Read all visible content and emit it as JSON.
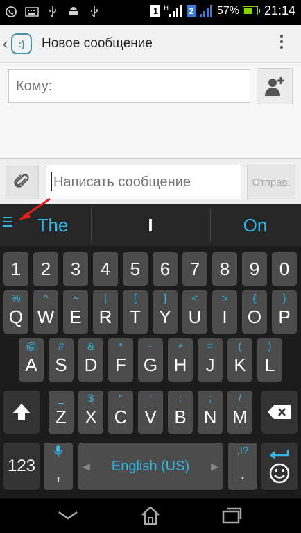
{
  "status_bar": {
    "sim1": "1",
    "net_tag": "H",
    "sim2": "2",
    "battery_percent": "57%",
    "battery_level": 0.57,
    "time": "21:14"
  },
  "action_bar": {
    "title": "Новое сообщение",
    "app_icon_glyph": ":)"
  },
  "recipient": {
    "placeholder": "Кому:"
  },
  "compose": {
    "placeholder": "Написать сообщение",
    "send_label": "Отправ."
  },
  "keyboard": {
    "suggestions": [
      "The",
      "I",
      "On"
    ],
    "number_row": [
      "1",
      "2",
      "3",
      "4",
      "5",
      "6",
      "7",
      "8",
      "9",
      "0"
    ],
    "row_q": {
      "keys": [
        "Q",
        "W",
        "E",
        "R",
        "T",
        "Y",
        "U",
        "I",
        "O",
        "P"
      ],
      "hints": [
        "%",
        "^",
        "~",
        "|",
        "[",
        "]",
        "<",
        ">",
        "{",
        "}"
      ]
    },
    "row_a": {
      "keys": [
        "A",
        "S",
        "D",
        "F",
        "G",
        "H",
        "J",
        "K",
        "L"
      ],
      "hints": [
        "@",
        "#",
        "&",
        "*",
        "-",
        "+",
        "=",
        "(",
        ")"
      ]
    },
    "row_z": {
      "keys": [
        "Z",
        "X",
        "C",
        "V",
        "B",
        "N",
        "M"
      ],
      "hints": [
        "_",
        "$",
        "\"",
        "'",
        ":",
        ";",
        "/"
      ]
    },
    "sym_key": "123",
    "comma_key": ",",
    "space_label": "English (US)",
    "period_key": ".",
    "period_hint": ",!?",
    "accent_color": "#33b5e5"
  }
}
